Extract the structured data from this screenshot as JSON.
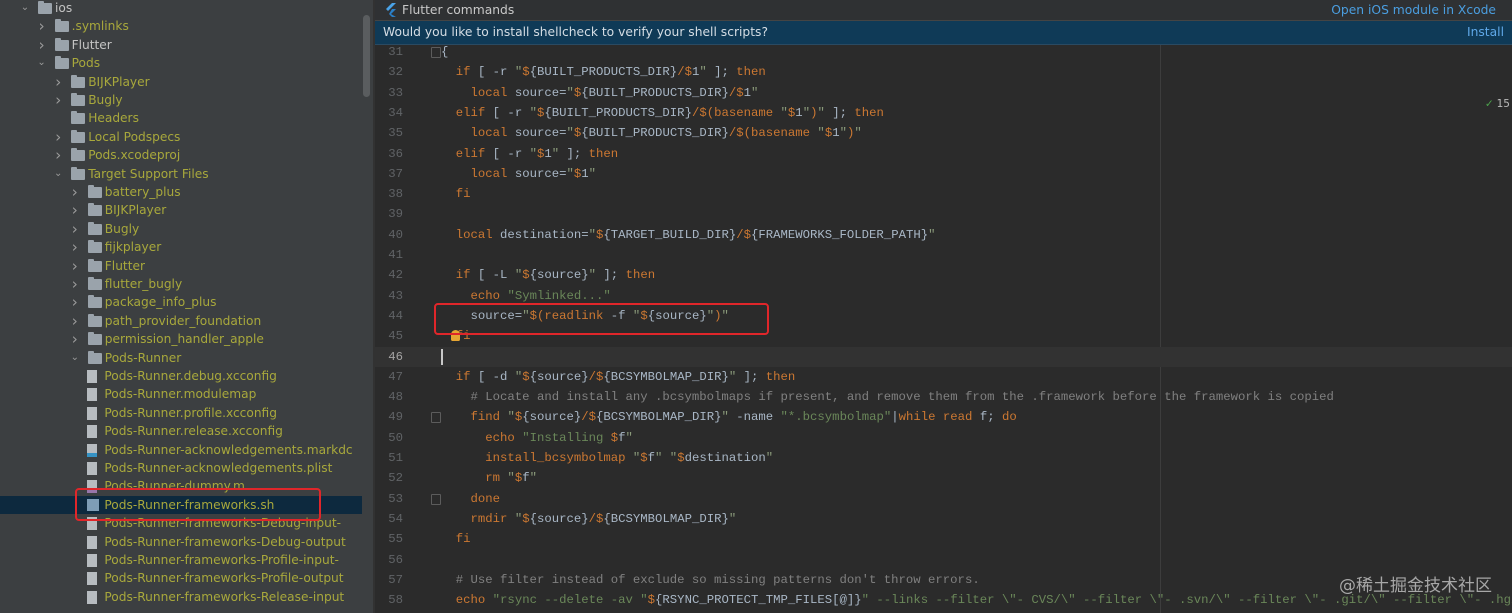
{
  "colors": {
    "accent": "#4a9ee0",
    "selection": "#0d293e",
    "keyword": "#cc7832",
    "string": "#6a8759",
    "highlight_box": "#e0262a"
  },
  "sidebar": {
    "items": [
      {
        "label": "ios",
        "level": 0,
        "kind": "folder",
        "arrow": "open",
        "white": true
      },
      {
        "label": ".symlinks",
        "level": 1,
        "kind": "folder",
        "arrow": "closed"
      },
      {
        "label": "Flutter",
        "level": 1,
        "kind": "folder",
        "arrow": "closed",
        "white": true
      },
      {
        "label": "Pods",
        "level": 1,
        "kind": "folder",
        "arrow": "open"
      },
      {
        "label": "BIJKPlayer",
        "level": 2,
        "kind": "folder",
        "arrow": "closed"
      },
      {
        "label": "Bugly",
        "level": 2,
        "kind": "folder",
        "arrow": "closed"
      },
      {
        "label": "Headers",
        "level": 2,
        "kind": "folder",
        "arrow": "none"
      },
      {
        "label": "Local Podspecs",
        "level": 2,
        "kind": "folder",
        "arrow": "closed"
      },
      {
        "label": "Pods.xcodeproj",
        "level": 2,
        "kind": "folder",
        "arrow": "closed"
      },
      {
        "label": "Target Support Files",
        "level": 2,
        "kind": "folder",
        "arrow": "open"
      },
      {
        "label": "battery_plus",
        "level": 3,
        "kind": "folder",
        "arrow": "closed"
      },
      {
        "label": "BIJKPlayer",
        "level": 3,
        "kind": "folder",
        "arrow": "closed"
      },
      {
        "label": "Bugly",
        "level": 3,
        "kind": "folder",
        "arrow": "closed"
      },
      {
        "label": "fijkplayer",
        "level": 3,
        "kind": "folder",
        "arrow": "closed"
      },
      {
        "label": "Flutter",
        "level": 3,
        "kind": "folder",
        "arrow": "closed"
      },
      {
        "label": "flutter_bugly",
        "level": 3,
        "kind": "folder",
        "arrow": "closed"
      },
      {
        "label": "package_info_plus",
        "level": 3,
        "kind": "folder",
        "arrow": "closed"
      },
      {
        "label": "path_provider_foundation",
        "level": 3,
        "kind": "folder",
        "arrow": "closed"
      },
      {
        "label": "permission_handler_apple",
        "level": 3,
        "kind": "folder",
        "arrow": "closed"
      },
      {
        "label": "Pods-Runner",
        "level": 3,
        "kind": "folder",
        "arrow": "open"
      },
      {
        "label": "Pods-Runner.debug.xcconfig",
        "level": 4,
        "kind": "file"
      },
      {
        "label": "Pods-Runner.modulemap",
        "level": 4,
        "kind": "file"
      },
      {
        "label": "Pods-Runner.profile.xcconfig",
        "level": 4,
        "kind": "file"
      },
      {
        "label": "Pods-Runner.release.xcconfig",
        "level": 4,
        "kind": "file"
      },
      {
        "label": "Pods-Runner-acknowledgements.markdc",
        "level": 4,
        "kind": "md"
      },
      {
        "label": "Pods-Runner-acknowledgements.plist",
        "level": 4,
        "kind": "file"
      },
      {
        "label": "Pods-Runner-dummy.m",
        "level": 4,
        "kind": "c"
      },
      {
        "label": "Pods-Runner-frameworks.sh",
        "level": 4,
        "kind": "sh",
        "selected": true
      },
      {
        "label": "Pods-Runner-frameworks-Debug-input-",
        "level": 4,
        "kind": "file"
      },
      {
        "label": "Pods-Runner-frameworks-Debug-output",
        "level": 4,
        "kind": "file"
      },
      {
        "label": "Pods-Runner-frameworks-Profile-input-",
        "level": 4,
        "kind": "file"
      },
      {
        "label": "Pods-Runner-frameworks-Profile-output",
        "level": 4,
        "kind": "file"
      },
      {
        "label": "Pods-Runner-frameworks-Release-input",
        "level": 4,
        "kind": "file"
      }
    ]
  },
  "topbar": {
    "title": "Flutter commands",
    "open_xcode": "Open iOS module in Xcode"
  },
  "banner": {
    "message": "Would you like to install shellcheck to verify your shell scripts?",
    "install": "Install"
  },
  "inspection": {
    "count": "15"
  },
  "editor": {
    "current_line": 46,
    "lines": [
      {
        "n": "31",
        "t": [
          [
            "p",
            "{"
          ]
        ]
      },
      {
        "n": "32",
        "t": [
          [
            "p",
            "  "
          ],
          [
            "k",
            "if"
          ],
          [
            "p",
            " [ -r "
          ],
          [
            "q",
            "\""
          ],
          [
            "d",
            "$"
          ],
          [
            "v",
            "{BUILT_PRODUCTS_DIR}"
          ],
          [
            "d",
            "/$"
          ],
          [
            "v",
            "1"
          ],
          [
            "q",
            "\""
          ],
          [
            "p",
            " ]; "
          ],
          [
            "k",
            "then"
          ]
        ]
      },
      {
        "n": "33",
        "t": [
          [
            "p",
            "    "
          ],
          [
            "k",
            "local"
          ],
          [
            "p",
            " source="
          ],
          [
            "q",
            "\""
          ],
          [
            "d",
            "$"
          ],
          [
            "v",
            "{BUILT_PRODUCTS_DIR}"
          ],
          [
            "d",
            "/$"
          ],
          [
            "v",
            "1"
          ],
          [
            "q",
            "\""
          ]
        ]
      },
      {
        "n": "34",
        "t": [
          [
            "p",
            "  "
          ],
          [
            "k",
            "elif"
          ],
          [
            "p",
            " [ -r "
          ],
          [
            "q",
            "\""
          ],
          [
            "d",
            "$"
          ],
          [
            "v",
            "{BUILT_PRODUCTS_DIR}"
          ],
          [
            "d",
            "/$("
          ],
          [
            "k",
            "basename"
          ],
          [
            "q",
            " \""
          ],
          [
            "d",
            "$"
          ],
          [
            "v",
            "1"
          ],
          [
            "q",
            "\""
          ],
          [
            "d",
            ")"
          ],
          [
            "q",
            "\""
          ],
          [
            "p",
            " ]; "
          ],
          [
            "k",
            "then"
          ]
        ]
      },
      {
        "n": "35",
        "t": [
          [
            "p",
            "    "
          ],
          [
            "k",
            "local"
          ],
          [
            "p",
            " source="
          ],
          [
            "q",
            "\""
          ],
          [
            "d",
            "$"
          ],
          [
            "v",
            "{BUILT_PRODUCTS_DIR}"
          ],
          [
            "d",
            "/$("
          ],
          [
            "k",
            "basename"
          ],
          [
            "q",
            " \""
          ],
          [
            "d",
            "$"
          ],
          [
            "v",
            "1"
          ],
          [
            "q",
            "\""
          ],
          [
            "d",
            ")"
          ],
          [
            "q",
            "\""
          ]
        ]
      },
      {
        "n": "36",
        "t": [
          [
            "p",
            "  "
          ],
          [
            "k",
            "elif"
          ],
          [
            "p",
            " [ -r "
          ],
          [
            "q",
            "\""
          ],
          [
            "d",
            "$"
          ],
          [
            "v",
            "1"
          ],
          [
            "q",
            "\""
          ],
          [
            "p",
            " ]; "
          ],
          [
            "k",
            "then"
          ]
        ]
      },
      {
        "n": "37",
        "t": [
          [
            "p",
            "    "
          ],
          [
            "k",
            "local"
          ],
          [
            "p",
            " source="
          ],
          [
            "q",
            "\""
          ],
          [
            "d",
            "$"
          ],
          [
            "v",
            "1"
          ],
          [
            "q",
            "\""
          ]
        ]
      },
      {
        "n": "38",
        "t": [
          [
            "p",
            "  "
          ],
          [
            "k",
            "fi"
          ]
        ]
      },
      {
        "n": "39",
        "t": []
      },
      {
        "n": "40",
        "t": [
          [
            "p",
            "  "
          ],
          [
            "k",
            "local"
          ],
          [
            "p",
            " destination="
          ],
          [
            "q",
            "\""
          ],
          [
            "d",
            "$"
          ],
          [
            "v",
            "{TARGET_BUILD_DIR}"
          ],
          [
            "d",
            "/$"
          ],
          [
            "v",
            "{FRAMEWORKS_FOLDER_PATH}"
          ],
          [
            "q",
            "\""
          ]
        ]
      },
      {
        "n": "41",
        "t": []
      },
      {
        "n": "42",
        "t": [
          [
            "p",
            "  "
          ],
          [
            "k",
            "if"
          ],
          [
            "p",
            " [ -L "
          ],
          [
            "q",
            "\""
          ],
          [
            "d",
            "$"
          ],
          [
            "v",
            "{source}"
          ],
          [
            "q",
            "\""
          ],
          [
            "p",
            " ]; "
          ],
          [
            "k",
            "then"
          ]
        ]
      },
      {
        "n": "43",
        "t": [
          [
            "p",
            "    "
          ],
          [
            "k",
            "echo"
          ],
          [
            "s",
            " \"Symlinked...\""
          ]
        ]
      },
      {
        "n": "44",
        "t": [
          [
            "p",
            "    source="
          ],
          [
            "q",
            "\""
          ],
          [
            "d",
            "$("
          ],
          [
            "k",
            "readlink"
          ],
          [
            "p",
            " -f "
          ],
          [
            "q",
            "\""
          ],
          [
            "d",
            "$"
          ],
          [
            "v",
            "{source}"
          ],
          [
            "q",
            "\""
          ],
          [
            "d",
            ")"
          ],
          [
            "q",
            "\""
          ]
        ]
      },
      {
        "n": "45",
        "t": [
          [
            "p",
            "  "
          ],
          [
            "k",
            "fi"
          ]
        ]
      },
      {
        "n": "46",
        "t": []
      },
      {
        "n": "47",
        "t": [
          [
            "p",
            "  "
          ],
          [
            "k",
            "if"
          ],
          [
            "p",
            " [ -d "
          ],
          [
            "q",
            "\""
          ],
          [
            "d",
            "$"
          ],
          [
            "v",
            "{source}"
          ],
          [
            "d",
            "/$"
          ],
          [
            "v",
            "{BCSYMBOLMAP_DIR}"
          ],
          [
            "q",
            "\""
          ],
          [
            "p",
            " ]; "
          ],
          [
            "k",
            "then"
          ]
        ]
      },
      {
        "n": "48",
        "t": [
          [
            "p",
            "    "
          ],
          [
            "c",
            "# Locate and install any .bcsymbolmaps if present, and remove them from the .framework before the framework is copied"
          ]
        ]
      },
      {
        "n": "49",
        "t": [
          [
            "p",
            "    "
          ],
          [
            "k",
            "find"
          ],
          [
            "q",
            " \""
          ],
          [
            "d",
            "$"
          ],
          [
            "v",
            "{source}"
          ],
          [
            "d",
            "/$"
          ],
          [
            "v",
            "{BCSYMBOLMAP_DIR}"
          ],
          [
            "q",
            "\""
          ],
          [
            "p",
            " -name "
          ],
          [
            "s",
            "\"*.bcsymbolmap\""
          ],
          [
            "p",
            "|"
          ],
          [
            "k",
            "while"
          ],
          [
            "p",
            " "
          ],
          [
            "k",
            "read"
          ],
          [
            "p",
            " f; "
          ],
          [
            "k",
            "do"
          ]
        ]
      },
      {
        "n": "50",
        "t": [
          [
            "p",
            "      "
          ],
          [
            "k",
            "echo"
          ],
          [
            "s",
            " \"Installing "
          ],
          [
            "d",
            "$"
          ],
          [
            "v",
            "f"
          ],
          [
            "q",
            "\""
          ]
        ]
      },
      {
        "n": "51",
        "t": [
          [
            "p",
            "      "
          ],
          [
            "k",
            "install_bcsymbolmap"
          ],
          [
            "q",
            " \""
          ],
          [
            "d",
            "$"
          ],
          [
            "v",
            "f"
          ],
          [
            "q",
            "\" \""
          ],
          [
            "d",
            "$"
          ],
          [
            "v",
            "destination"
          ],
          [
            "q",
            "\""
          ]
        ]
      },
      {
        "n": "52",
        "t": [
          [
            "p",
            "      "
          ],
          [
            "k",
            "rm"
          ],
          [
            "q",
            " \""
          ],
          [
            "d",
            "$"
          ],
          [
            "v",
            "f"
          ],
          [
            "q",
            "\""
          ]
        ]
      },
      {
        "n": "53",
        "t": [
          [
            "p",
            "    "
          ],
          [
            "k",
            "done"
          ]
        ]
      },
      {
        "n": "54",
        "t": [
          [
            "p",
            "    "
          ],
          [
            "k",
            "rmdir"
          ],
          [
            "q",
            " \""
          ],
          [
            "d",
            "$"
          ],
          [
            "v",
            "{source}"
          ],
          [
            "d",
            "/$"
          ],
          [
            "v",
            "{BCSYMBOLMAP_DIR}"
          ],
          [
            "q",
            "\""
          ]
        ]
      },
      {
        "n": "55",
        "t": [
          [
            "p",
            "  "
          ],
          [
            "k",
            "fi"
          ]
        ]
      },
      {
        "n": "56",
        "t": []
      },
      {
        "n": "57",
        "t": [
          [
            "p",
            "  "
          ],
          [
            "c",
            "# Use filter instead of exclude so missing patterns don't throw errors."
          ]
        ]
      },
      {
        "n": "58",
        "t": [
          [
            "p",
            "  "
          ],
          [
            "k",
            "echo"
          ],
          [
            "s",
            " \"rsync --delete -av \""
          ],
          [
            "d",
            "$"
          ],
          [
            "v",
            "{RSYNC_PROTECT_TMP_FILES[@]}"
          ],
          [
            "s",
            "\" --links --filter \\\"- CVS/\\\" --filter \\\"- .svn/\\\" --filter \\\"- .git/\\\" --filter \\\"- .hg/\\\""
          ]
        ]
      }
    ]
  },
  "watermark": "@稀土掘金技术社区"
}
